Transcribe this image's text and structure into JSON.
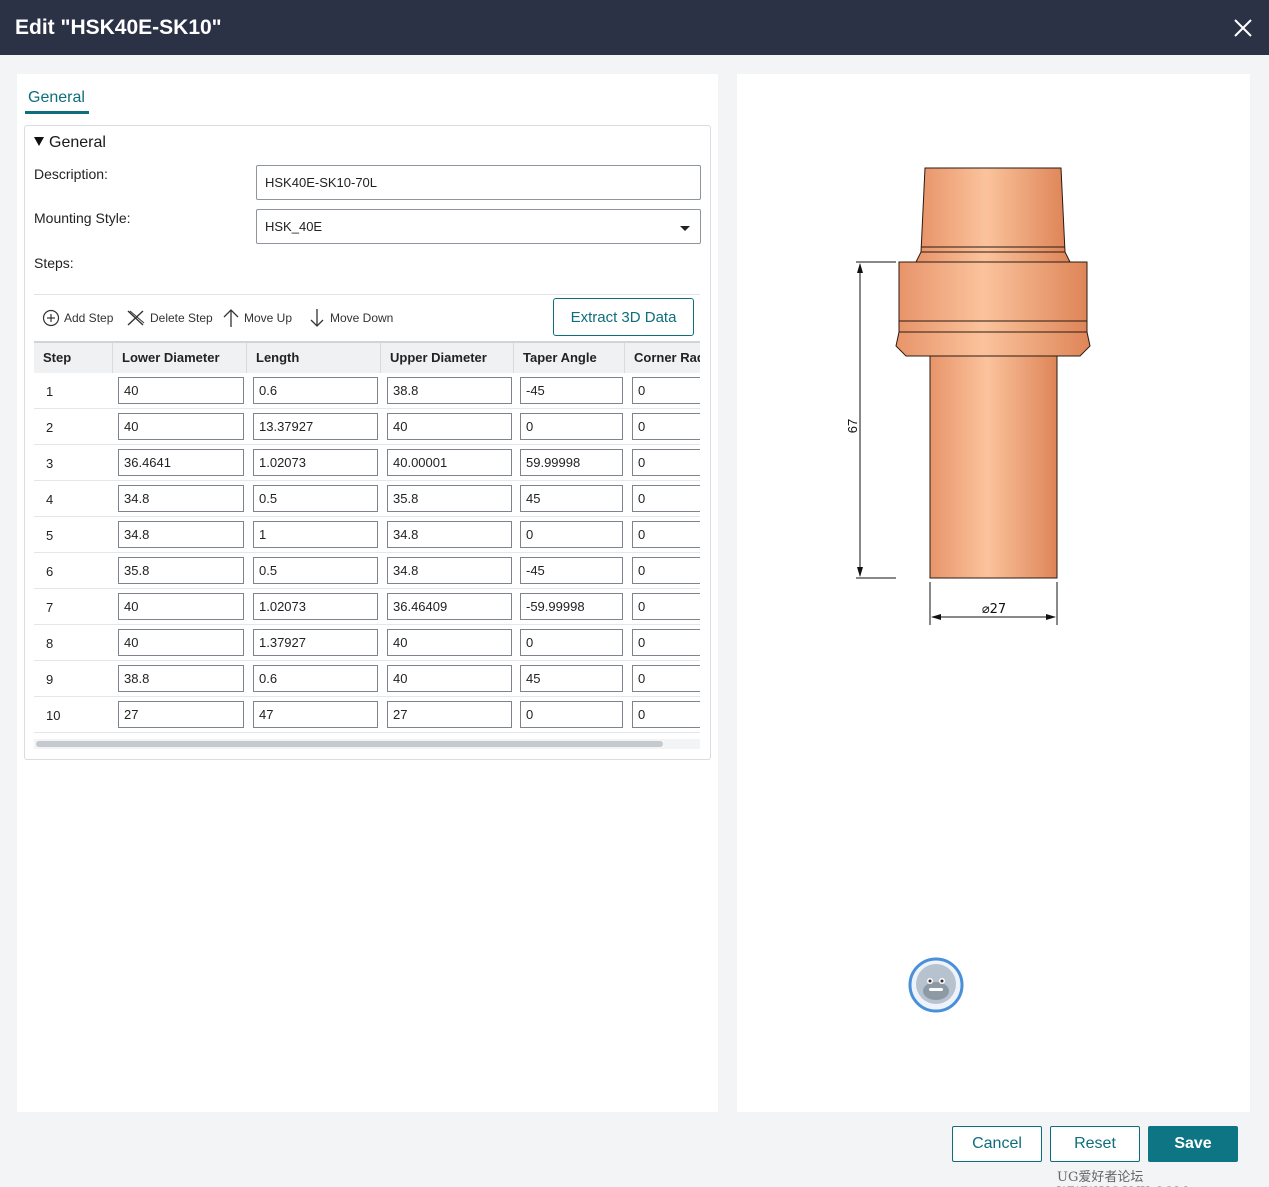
{
  "window": {
    "title": "Edit \"HSK40E-SK10\""
  },
  "tabs": [
    {
      "label": "General"
    }
  ],
  "section": {
    "title": "General"
  },
  "form": {
    "description_label": "Description:",
    "description_value": "HSK40E-SK10-70L",
    "mounting_label": "Mounting Style:",
    "mounting_value": "HSK_40E",
    "steps_label": "Steps:"
  },
  "toolbar": {
    "add_step": "Add Step",
    "delete_step": "Delete Step",
    "move_up": "Move Up",
    "move_down": "Move Down",
    "extract": "Extract 3D Data"
  },
  "table": {
    "columns": [
      "Step",
      "Lower Diameter",
      "Length",
      "Upper Diameter",
      "Taper Angle",
      "Corner Rad"
    ],
    "rows": [
      [
        "1",
        "40",
        "0.6",
        "38.8",
        "-45",
        "0"
      ],
      [
        "2",
        "40",
        "13.37927",
        "40",
        "0",
        "0"
      ],
      [
        "3",
        "36.4641",
        "1.02073",
        "40.00001",
        "59.99998",
        "0"
      ],
      [
        "4",
        "34.8",
        "0.5",
        "35.8",
        "45",
        "0"
      ],
      [
        "5",
        "34.8",
        "1",
        "34.8",
        "0",
        "0"
      ],
      [
        "6",
        "35.8",
        "0.5",
        "34.8",
        "-45",
        "0"
      ],
      [
        "7",
        "40",
        "1.02073",
        "36.46409",
        "-59.99998",
        "0"
      ],
      [
        "8",
        "40",
        "1.37927",
        "40",
        "0",
        "0"
      ],
      [
        "9",
        "38.8",
        "0.6",
        "40",
        "45",
        "0"
      ],
      [
        "10",
        "27",
        "47",
        "27",
        "0",
        "0"
      ]
    ]
  },
  "drawing": {
    "height_dim": "67",
    "diameter_dim": "⌀27",
    "fill_color": "#eb9f72"
  },
  "buttons": {
    "cancel": "Cancel",
    "reset": "Reset",
    "save": "Save"
  },
  "watermark": "UG爱好者论坛 WWW.UGSNX.COM",
  "colors": {
    "accent": "#0e6f7c",
    "titlebar": "#2b3245"
  }
}
